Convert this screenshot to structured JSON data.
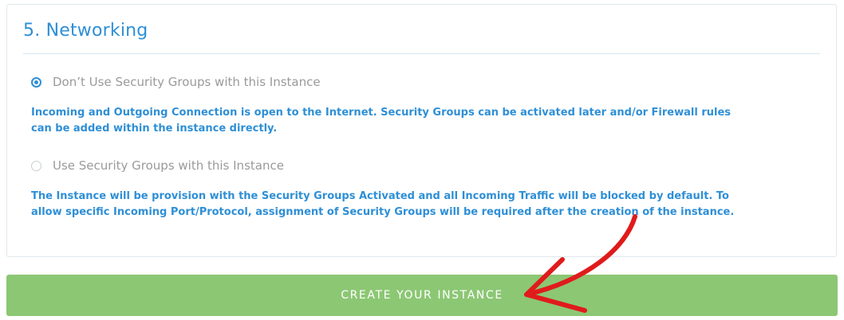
{
  "section": {
    "title": "5. Networking"
  },
  "options": [
    {
      "label": "Don’t Use Security Groups with this Instance",
      "selected": true,
      "description": "Incoming and Outgoing Connection is open to the Internet. Security Groups can be activated later and/or Firewall rules can be added within the instance directly."
    },
    {
      "label": "Use Security Groups with this Instance",
      "selected": false,
      "description": "The Instance will be provision with the Security Groups Activated and all Incoming Traffic will be blocked by default. To allow specific Incoming Port/Protocol, assignment of Security Groups will be required after the creation of the instance."
    }
  ],
  "actions": {
    "create_label": "CREATE YOUR INSTANCE"
  },
  "colors": {
    "accent": "#2e8fd6",
    "button": "#8cc774",
    "annotation_arrow": "#e01b1b",
    "muted_text": "#9a9a9a"
  },
  "icons": {
    "selected_radio": "radio-checked-icon",
    "unselected_radio": "radio-unchecked-icon",
    "annotation": "red-arrow-icon"
  }
}
